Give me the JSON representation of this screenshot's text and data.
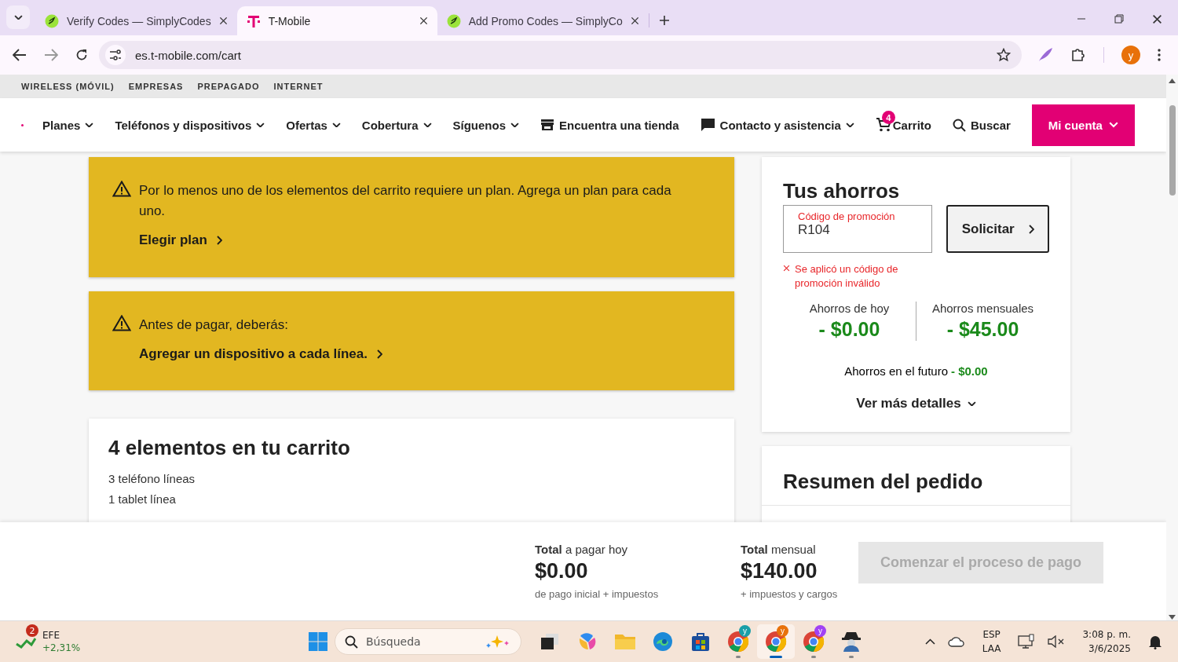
{
  "browser": {
    "tabs": [
      {
        "title": "Verify Codes — SimplyCodes",
        "selected": false,
        "kind": "coupon"
      },
      {
        "title": "T-Mobile",
        "selected": true,
        "kind": "brand"
      },
      {
        "title": "Add Promo Codes — SimplyCo",
        "selected": false,
        "kind": "coupon"
      }
    ],
    "address": "es.t-mobile.com/cart",
    "profile_initial": "y"
  },
  "utility_nav": [
    "WIRELESS (MÓVIL)",
    "EMPRESAS",
    "PREPAGADO",
    "INTERNET"
  ],
  "main_nav": [
    {
      "label": "Planes",
      "kind": "menu",
      "dropdown": true
    },
    {
      "label": "Teléfonos y dispositivos",
      "kind": "menu",
      "dropdown": true
    },
    {
      "label": "Ofertas",
      "kind": "menu",
      "dropdown": true
    },
    {
      "label": "Cobertura",
      "kind": "menu",
      "dropdown": true
    },
    {
      "label": "Síguenos",
      "kind": "menu",
      "dropdown": true
    },
    {
      "label": "Encuentra una tienda",
      "kind": "store",
      "dropdown": false
    },
    {
      "label": "Contacto y asistencia",
      "kind": "chat",
      "dropdown": true
    },
    {
      "label": "Carrito",
      "kind": "cart",
      "dropdown": false,
      "badge": "4"
    },
    {
      "label": "Buscar",
      "kind": "search",
      "dropdown": false
    }
  ],
  "account_button": "Mi cuenta",
  "alerts": [
    {
      "message": "Por lo menos uno de los elementos del carrito requiere un plan. Agrega un plan para cada uno.",
      "link": "Elegir plan"
    },
    {
      "message": "Antes de pagar, deberás:",
      "link": "Agregar un dispositivo a cada línea."
    }
  ],
  "cart": {
    "title": "4 elementos en tu carrito",
    "lines": [
      "3 teléfono líneas",
      "1 tablet línea"
    ]
  },
  "savings": {
    "title": "Tus ahorros",
    "promo_field": {
      "label": "Código de promoción",
      "value": "R104",
      "invalid": true
    },
    "apply_button": "Solicitar",
    "error": "Se aplicó un código de promoción inválido",
    "today_label": "Ahorros de hoy",
    "today_value": "- $0.00",
    "monthly_label": "Ahorros mensuales",
    "monthly_value": "- $45.00",
    "future_label": "Ahorros en el futuro",
    "future_value": "- $0.00",
    "details_link": "Ver más detalles"
  },
  "order_summary": {
    "title": "Resumen del pedido"
  },
  "checkout": {
    "totals": [
      {
        "label": "**Total** a pagar hoy",
        "amount": "$0.00",
        "note": "de pago inicial + impuestos"
      },
      {
        "label": "**Total** mensual",
        "amount": "$140.00",
        "note": "+ impuestos y cargos"
      }
    ],
    "button": {
      "label": "Comenzar el proceso de pago",
      "disabled": true
    }
  },
  "taskbar": {
    "widget": {
      "badge": "2",
      "title": "EFE",
      "change": "+2,31%"
    },
    "search_placeholder": "Búsqueda",
    "apps": [
      {
        "kind": "taskview",
        "running": false,
        "selected": false
      },
      {
        "kind": "copilot",
        "running": false,
        "selected": false
      },
      {
        "kind": "folder",
        "running": false,
        "selected": false
      },
      {
        "kind": "edge",
        "running": false,
        "selected": false
      },
      {
        "kind": "store",
        "running": false,
        "selected": false
      },
      {
        "kind": "chrome",
        "badge": "y",
        "color": "#1a9fa8",
        "running": true,
        "selected": false
      },
      {
        "kind": "chrome",
        "badge": "y",
        "color": "#e8710a",
        "running": true,
        "selected": true
      },
      {
        "kind": "chrome",
        "badge": "y",
        "color": "#a142f4",
        "running": true,
        "selected": false
      },
      {
        "kind": "spy",
        "running": true,
        "selected": false
      }
    ],
    "language": [
      "ESP",
      "LAA"
    ],
    "time": "3:08 p. m.",
    "date": "3/6/2025"
  }
}
